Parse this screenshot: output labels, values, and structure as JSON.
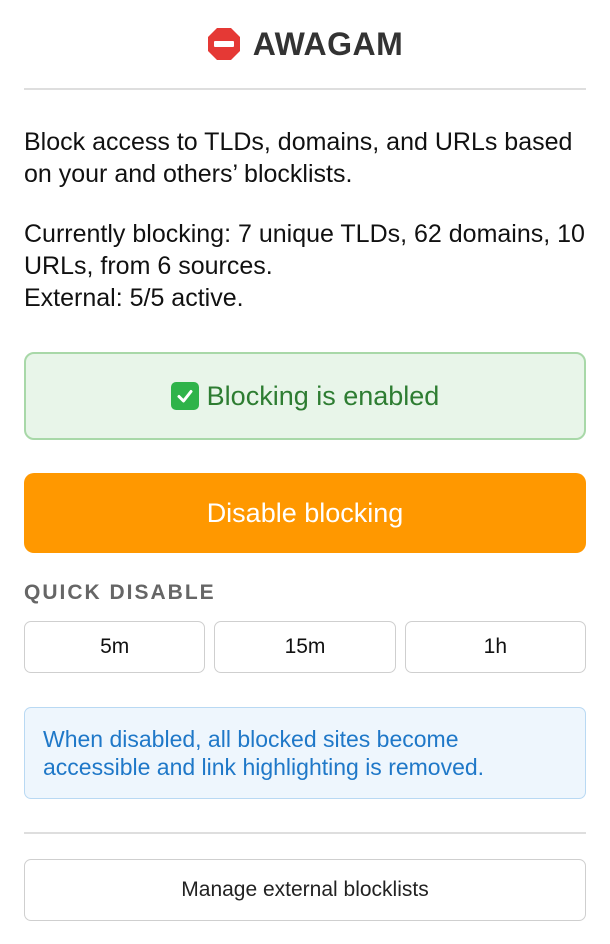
{
  "header": {
    "title": "AWAGAM",
    "icon": "stop-sign-icon",
    "icon_color": "#e53935"
  },
  "description": "Block access to TLDs, domains, and URLs based on your and others’ blocklists.",
  "stats": {
    "line1": "Currently blocking: 7 unique TLDs, 62 domains, 10 URLs, from 6 sources.",
    "line2": "External: 5/5 active."
  },
  "status": {
    "icon": "check-icon",
    "text": "Blocking is enabled",
    "color": "#2e7d32",
    "background": "#e8f5e9"
  },
  "disable_button": {
    "label": "Disable blocking",
    "color": "#ff9800"
  },
  "quick_disable": {
    "label": "QUICK DISABLE",
    "options": [
      "5m",
      "15m",
      "1h"
    ]
  },
  "info": {
    "text": "When disabled, all blocked sites become accessible and link highlighting is removed.",
    "color": "#1f78c8"
  },
  "manage_button": {
    "label": "Manage external blocklists"
  }
}
